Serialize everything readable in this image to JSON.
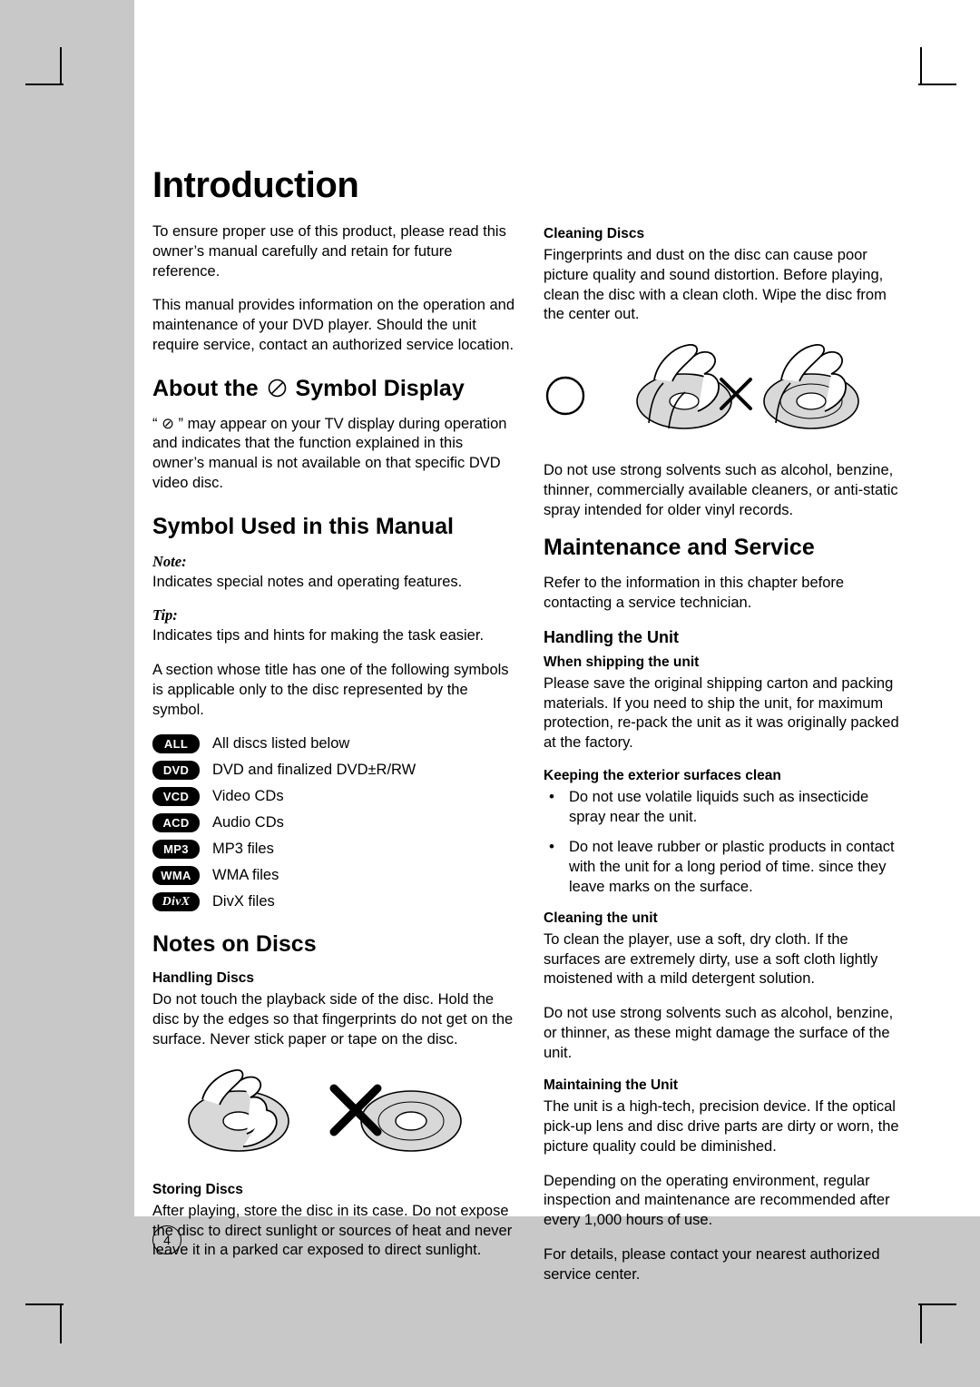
{
  "page": {
    "title": "Introduction",
    "number": "4"
  },
  "left_column": {
    "intro_p1": "To ensure proper use of this product, please read this owner’s manual carefully and retain for future reference.",
    "intro_p2": "This manual provides information on the operation and maintenance of your DVD player. Should the unit require service, contact an authorized service location.",
    "heading_symbol_display_pre": "About the",
    "heading_symbol_display_post": "Symbol Display",
    "symbol_display_p1": "“ ⊘ ” may appear on your TV display during operation and indicates that the function explained in this owner’s manual is not available on that specific DVD video disc.",
    "heading_symbol_used": "Symbol Used in this Manual",
    "note_word": "Note:",
    "note_text": "Indicates special notes and operating features.",
    "tip_word": "Tip:",
    "tip_text": "Indicates tips and hints for making the task easier.",
    "section_text": "A section whose title has one of the following symbols is applicable only to the disc represented by the symbol.",
    "symbols": [
      {
        "badge": "ALL",
        "label": "All discs listed below"
      },
      {
        "badge": "DVD",
        "label": "DVD and finalized DVD±R/RW"
      },
      {
        "badge": "VCD",
        "label": "Video CDs"
      },
      {
        "badge": "ACD",
        "label": "Audio CDs"
      },
      {
        "badge": "MP3",
        "label": "MP3 files"
      },
      {
        "badge": "WMA",
        "label": "WMA files"
      },
      {
        "badge": "DivX",
        "label": "DivX files"
      }
    ],
    "heading_notes_on_discs": "Notes on Discs",
    "handling_discs_heading": "Handling Discs",
    "handling_discs_text": "Do not touch the playback side of the disc. Hold the disc by the edges so that fingerprints do not get on the surface. Never stick paper or tape on the disc.",
    "storing_discs_heading": "Storing Discs",
    "storing_discs_text": "After playing, store the disc in its case. Do not expose the disc to direct sunlight or sources of heat and never leave it in a parked car exposed to direct sunlight."
  },
  "right_column": {
    "cleaning_discs_heading": "Cleaning Discs",
    "cleaning_discs_text": "Fingerprints and dust on the disc can cause poor picture quality and sound distortion. Before playing, clean the disc with a clean cloth. Wipe the disc from the center out.",
    "solvents_text": "Do not use strong solvents such as alcohol, benzine, thinner, commercially available cleaners, or anti-static spray intended for older vinyl records.",
    "heading_maintenance": "Maintenance and Service",
    "maintenance_text": "Refer to the information in this chapter before contacting a service technician.",
    "handling_unit_heading": "Handling the Unit",
    "when_shipping_heading": "When shipping the unit",
    "when_shipping_text": "Please save the original shipping carton and packing materials. If you need to ship the unit, for maximum protection, re-pack the unit as it was originally packed at the factory.",
    "keeping_clean_heading": "Keeping the exterior surfaces clean",
    "keeping_clean_bullets": [
      "Do not use volatile liquids such as insecticide spray near the unit.",
      "Do not leave rubber or plastic products in contact with the unit for a long period of time. since they leave marks on the surface."
    ],
    "cleaning_unit_heading": "Cleaning the unit",
    "cleaning_unit_text1": "To clean the player, use a soft, dry cloth. If the surfaces are extremely dirty, use a soft cloth lightly moistened with a mild detergent solution.",
    "cleaning_unit_text2": "Do not use strong solvents such as alcohol, benzine, or thinner, as these might damage the surface of the unit.",
    "maintaining_unit_heading": "Maintaining the Unit",
    "maintaining_text1": "The unit is a high-tech, precision device. If the optical pick-up lens and disc drive parts are dirty or worn, the picture quality could be diminished.",
    "maintaining_text2": "Depending on the operating environment, regular inspection and maintenance are recommended after every 1,000 hours of use.",
    "maintaining_text3": "For details, please contact your nearest authorized service center."
  }
}
